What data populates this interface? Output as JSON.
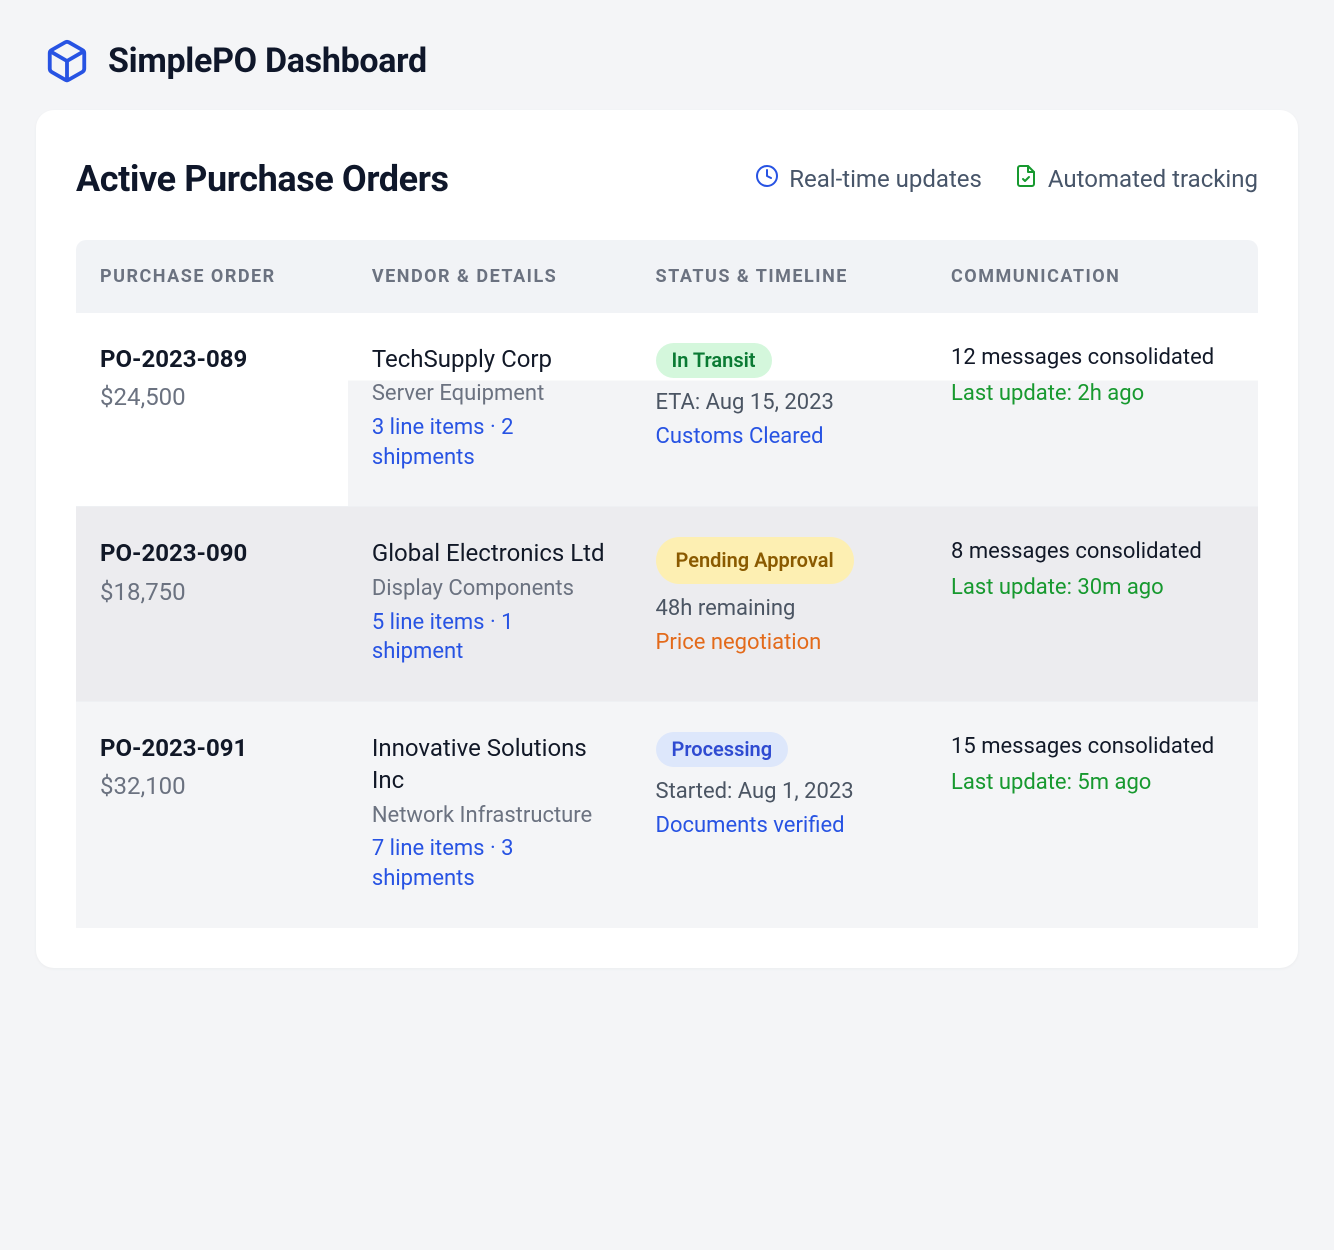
{
  "header": {
    "app_title": "SimplePO Dashboard"
  },
  "card": {
    "title": "Active Purchase Orders",
    "indicators": {
      "realtime": "Real-time updates",
      "tracking": "Automated tracking"
    }
  },
  "columns": {
    "po": "PURCHASE ORDER",
    "vendor": "VENDOR & DETAILS",
    "status": "STATUS & TIMELINE",
    "comm": "COMMUNICATION"
  },
  "rows": [
    {
      "po_id": "PO-2023-089",
      "amount": "$24,500",
      "vendor_name": "TechSupply Corp",
      "vendor_desc": "Server Equipment",
      "vendor_meta": "3 line items · 2 shipments",
      "badge_label": "In Transit",
      "badge_class": "transit",
      "status_sub": "ETA: Aug 15, 2023",
      "status_note": "Customs Cleared",
      "status_note_class": "note-blue",
      "comm_main": "12 messages consolidated",
      "comm_update": "Last update: 2h ago"
    },
    {
      "po_id": "PO-2023-090",
      "amount": "$18,750",
      "vendor_name": "Global Electronics Ltd",
      "vendor_desc": "Display Components",
      "vendor_meta": "5 line items · 1 shipment",
      "badge_label": "Pending Approval",
      "badge_class": "pending",
      "status_sub": "48h remaining",
      "status_note": "Price negotiation",
      "status_note_class": "note-orange",
      "comm_main": "8 messages consolidated",
      "comm_update": "Last update: 30m ago"
    },
    {
      "po_id": "PO-2023-091",
      "amount": "$32,100",
      "vendor_name": "Innovative Solutions Inc",
      "vendor_desc": "Network Infrastructure",
      "vendor_meta": "7 line items · 3 shipments",
      "badge_label": "Processing",
      "badge_class": "processing",
      "status_sub": "Started: Aug 1, 2023",
      "status_note": "Documents verified",
      "status_note_class": "note-blue",
      "comm_main": "15 messages consolidated",
      "comm_update": "Last update: 5m ago"
    }
  ]
}
